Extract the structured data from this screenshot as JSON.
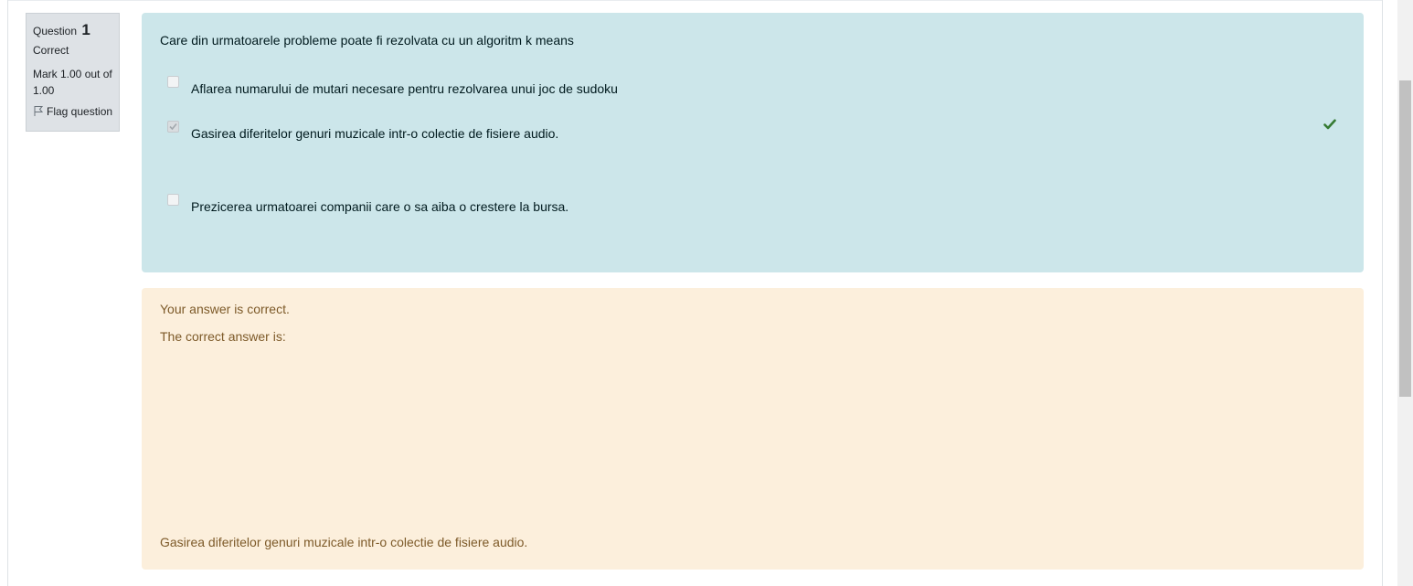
{
  "question_info": {
    "label": "Question",
    "number": "1",
    "state": "Correct",
    "grade": "Mark 1.00 out of 1.00",
    "flag_label": "Flag question"
  },
  "formulation": {
    "question_text": "Care din urmatoarele probleme poate fi rezolvata cu un algoritm k means",
    "answers": [
      {
        "label": "Aflarea numarului de mutari necesare pentru rezolvarea unui joc de sudoku",
        "checked": false
      },
      {
        "label": "Gasirea diferitelor genuri muzicale intr-o colectie de fisiere audio.",
        "checked": true
      },
      {
        "label": "Prezicerea urmatoarei companii care o sa aiba o crestere la bursa.",
        "checked": false
      }
    ]
  },
  "feedback": {
    "result": "Your answer is correct.",
    "correct_answer_label": "The correct answer is:",
    "correct_answer": "Gasirea diferitelor genuri muzicale intr-o colectie de fisiere audio."
  },
  "colors": {
    "formulation_bg": "#cce6ea",
    "outcome_bg": "#fcefdc",
    "correct_green": "#357a32"
  },
  "icons": {
    "flag": "flag-icon",
    "correct": "check-icon"
  }
}
